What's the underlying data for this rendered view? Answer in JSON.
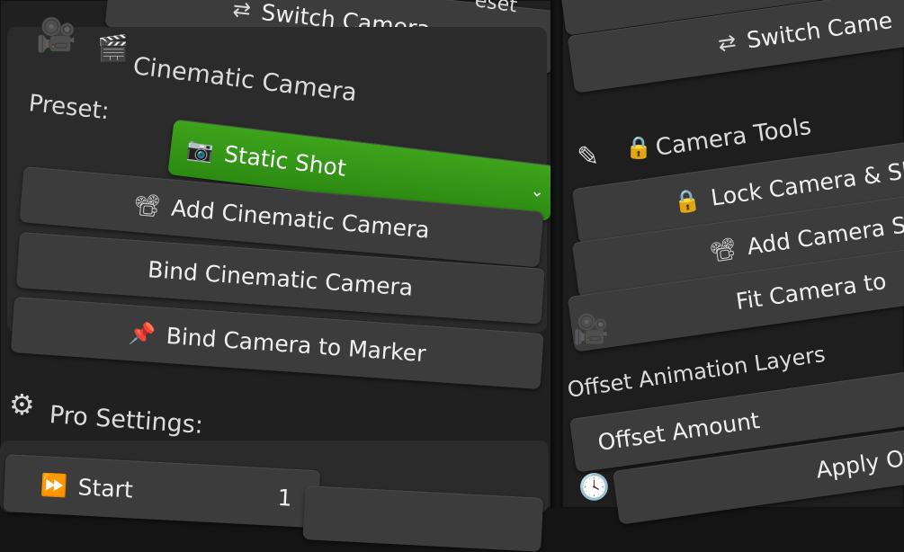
{
  "left": {
    "switch_camera_top": "Switch Camera",
    "top_right_partial": "eset",
    "section_title": "Cinematic Camera",
    "preset_label": "Preset:",
    "preset_value": "Static Shot",
    "add_cinematic_camera": "Add Cinematic Camera",
    "bind_cinematic_camera": "Bind Cinematic Camera",
    "bind_camera_to_marker": "Bind Camera to Marker",
    "pro_settings": "Pro Settings:",
    "start_label": "Start",
    "start_value": "1"
  },
  "right": {
    "switch_camera": "Switch Came",
    "camera_tools": "Camera Tools",
    "lock_camera": "Lock Camera & Sl",
    "add_camera": "Add Camera S",
    "fit_camera": "Fit Camera to",
    "offset_animation_layers": "Offset Animation Layers",
    "offset_amount": "Offset Amount",
    "apply_offset": "Apply Off"
  },
  "icons": {
    "camera": "camera-icon",
    "clapper": "clapperboard-icon",
    "photo": "photo-camera-icon",
    "movie_camera": "movie-camera-icon",
    "pin": "pin-icon",
    "gear": "gear-icon",
    "forward": "fast-forward-icon",
    "lock": "lock-icon",
    "swap": "switch-icon",
    "tools": "tools-icon",
    "clock": "clock-icon"
  }
}
